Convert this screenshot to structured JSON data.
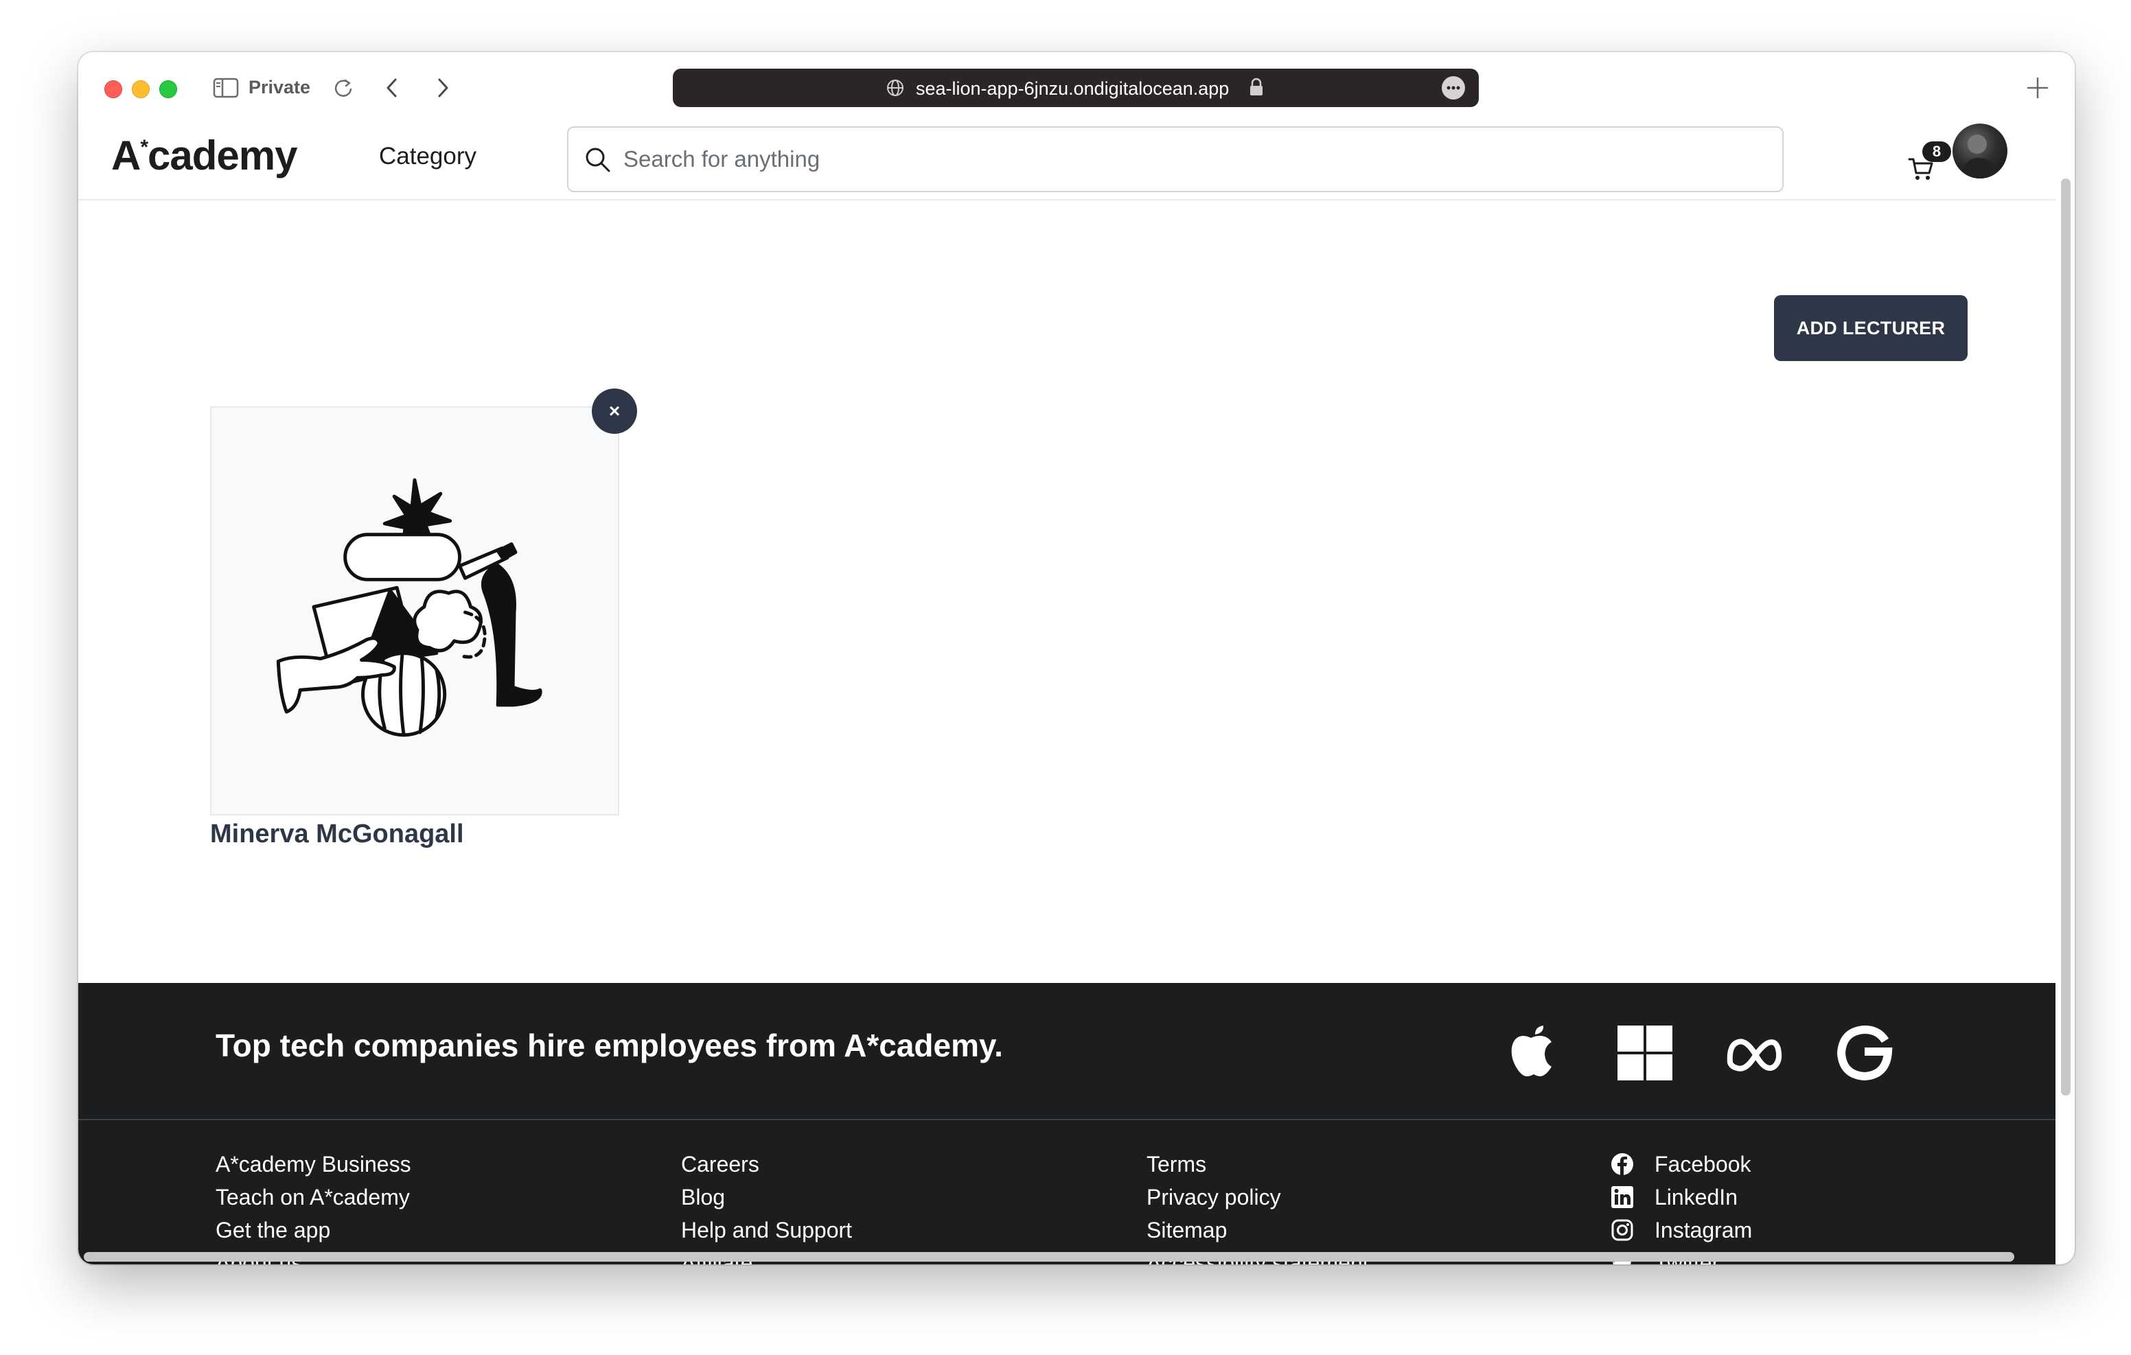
{
  "browser": {
    "private_label": "Private",
    "url": "sea-lion-app-6jnzu.ondigitalocean.app"
  },
  "header": {
    "logo_main": "A",
    "logo_star": "*",
    "logo_rest": "cademy",
    "category_label": "Category",
    "search_placeholder": "Search for anything",
    "cart_count": "8"
  },
  "main": {
    "add_lecturer_label": "ADD LECTURER",
    "remove_label": "×",
    "lecturers": [
      {
        "name": "Minerva McGonagall"
      }
    ]
  },
  "footer": {
    "headline": "Top tech companies hire employees from A*cademy.",
    "companies": [
      "apple-icon",
      "microsoft-icon",
      "meta-icon",
      "google-icon"
    ],
    "columns": [
      [
        "A*cademy Business",
        "Teach on A*cademy",
        "Get the app",
        "About us"
      ],
      [
        "Careers",
        "Blog",
        "Help and Support",
        "Affiliate"
      ],
      [
        "Terms",
        "Privacy policy",
        "Sitemap",
        "Accessibility statement"
      ]
    ],
    "social": [
      {
        "label": "Facebook",
        "icon": "facebook-icon"
      },
      {
        "label": "LinkedIn",
        "icon": "linkedin-icon"
      },
      {
        "label": "Instagram",
        "icon": "instagram-icon"
      },
      {
        "label": "Twitter",
        "icon": "twitter-icon"
      }
    ]
  },
  "colors": {
    "button_dark": "#2d3748",
    "footer_bg": "#1c1d1f",
    "url_bar_bg": "#2b2527"
  }
}
